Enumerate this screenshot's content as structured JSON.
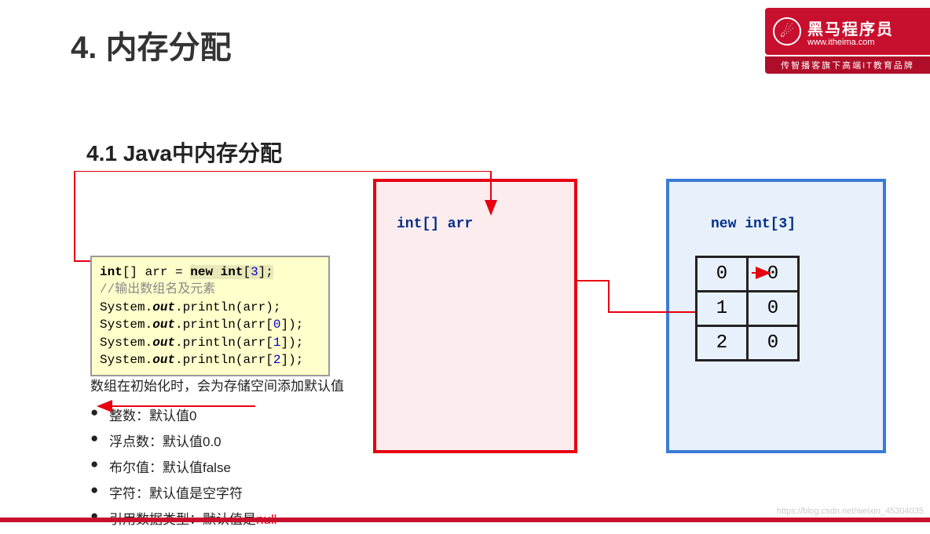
{
  "brand": {
    "title": "黑马程序员",
    "url": "www.itheima.com",
    "subtitle": "传智播客旗下高端IT教育品牌"
  },
  "slide": {
    "title": "4. 内存分配",
    "section": "4.1 Java中内存分配"
  },
  "stack": {
    "label": "int[] arr"
  },
  "heap": {
    "label": "new int[3]",
    "rows": [
      {
        "idx": "0",
        "val": "0"
      },
      {
        "idx": "1",
        "val": "0"
      },
      {
        "idx": "2",
        "val": "0"
      }
    ]
  },
  "code": {
    "l1a": "int",
    "l1b": "[] arr = ",
    "l1c": "new int",
    "l1d": "[",
    "l1e": "3",
    "l1f": "];",
    "l2": "//输出数组名及元素",
    "l3a": "System.",
    "l3b": "out",
    "l3c": ".println(arr);",
    "l4a": "System.",
    "l4b": "out",
    "l4c": ".println(arr[",
    "l4d": "0",
    "l4e": "]);",
    "l5a": "System.",
    "l5b": "out",
    "l5c": ".println(arr[",
    "l5d": "1",
    "l5e": "]);",
    "l6a": "System.",
    "l6b": "out",
    "l6c": ".println(arr[",
    "l6d": "2",
    "l6e": "]);"
  },
  "desc": "数组在初始化时，会为存储空间添加默认值",
  "bullets": {
    "b1": "整数：默认值0",
    "b2": "浮点数：默认值0.0",
    "b3": "布尔值：默认值false",
    "b4": "字符：默认值是空字符",
    "b5a": "引用数据类型：默认值是",
    "b5b": "null"
  },
  "watermark": "https://blog.csdn.net/weixin_45304035"
}
